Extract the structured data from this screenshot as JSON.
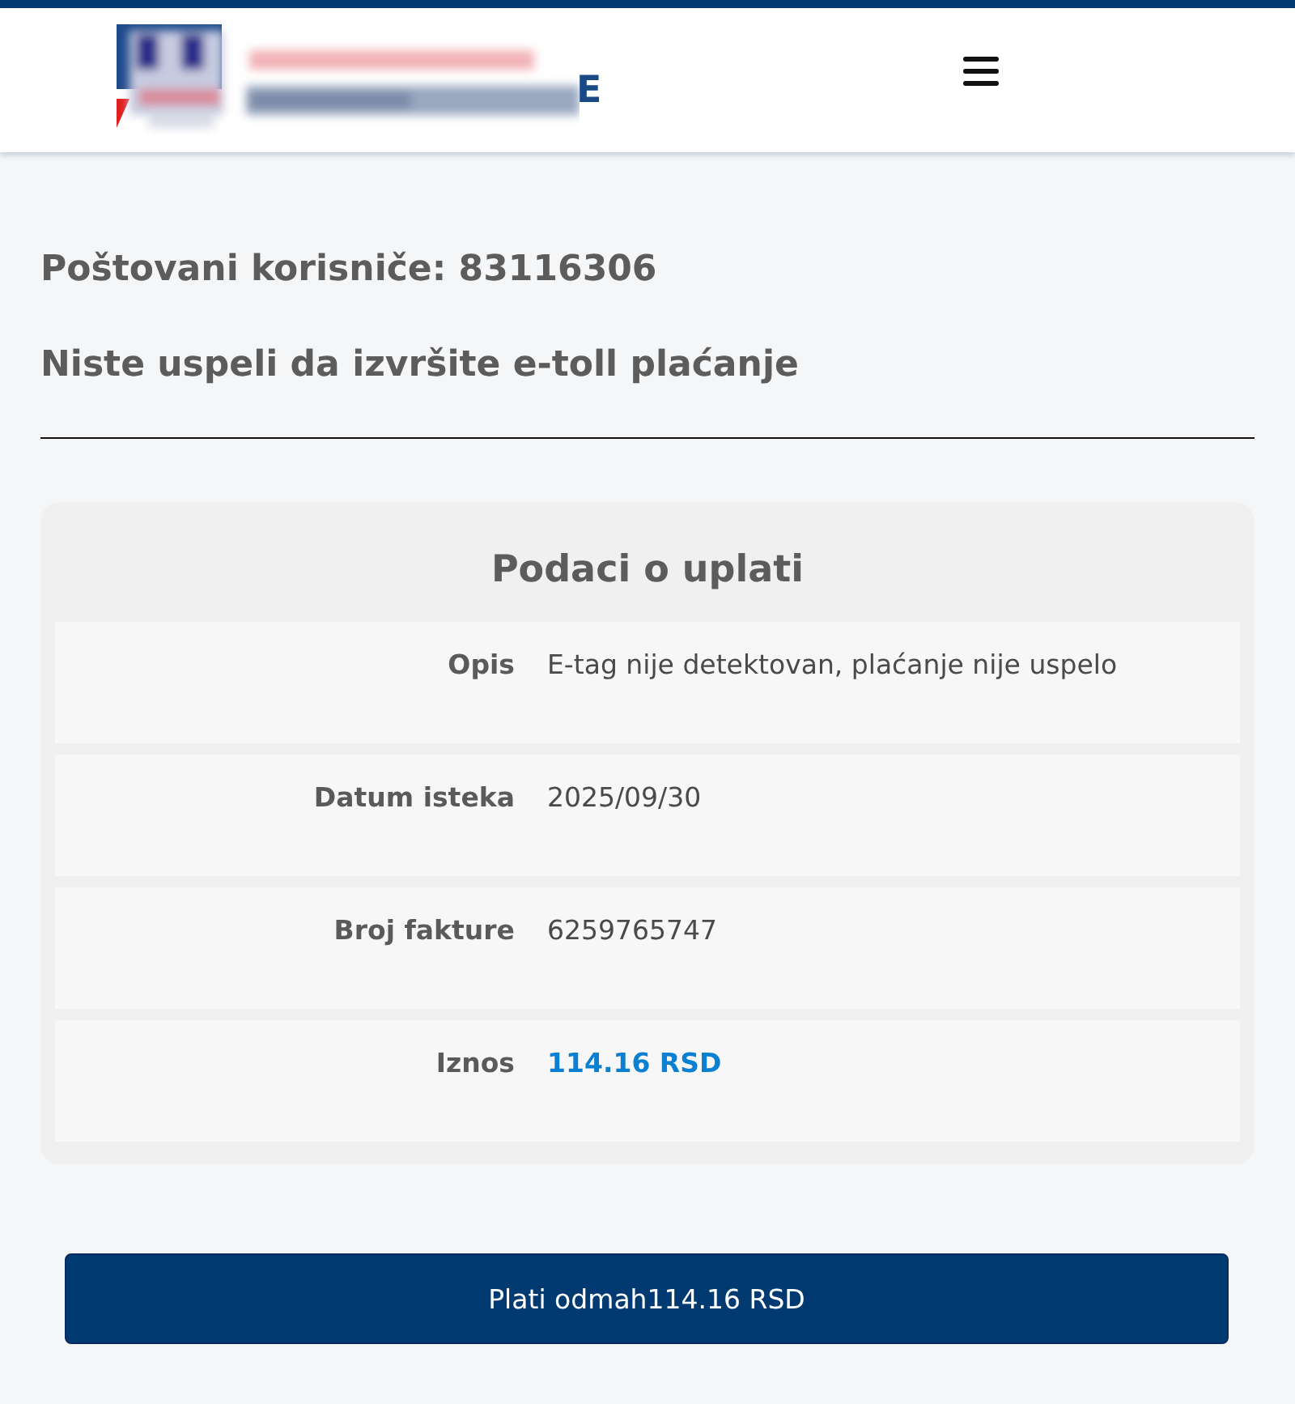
{
  "header": {
    "logo": {
      "letter": "E"
    }
  },
  "greeting": "Poštovani korisniče: 83116306",
  "message": "Niste uspeli da izvršite e-toll plaćanje",
  "payment_details": {
    "title": "Podaci o uplati",
    "rows": [
      {
        "label": "Opis",
        "value": "E-tag nije detektovan, plaćanje nije uspelo",
        "kind": "text"
      },
      {
        "label": "Datum isteka",
        "value": "2025/09/30",
        "kind": "text"
      },
      {
        "label": "Broj fakture",
        "value": "6259765747",
        "kind": "text"
      },
      {
        "label": "Iznos",
        "value": "114.16 RSD",
        "kind": "amount"
      }
    ]
  },
  "pay_button": {
    "label": "Plati odmah114.16 RSD"
  }
}
